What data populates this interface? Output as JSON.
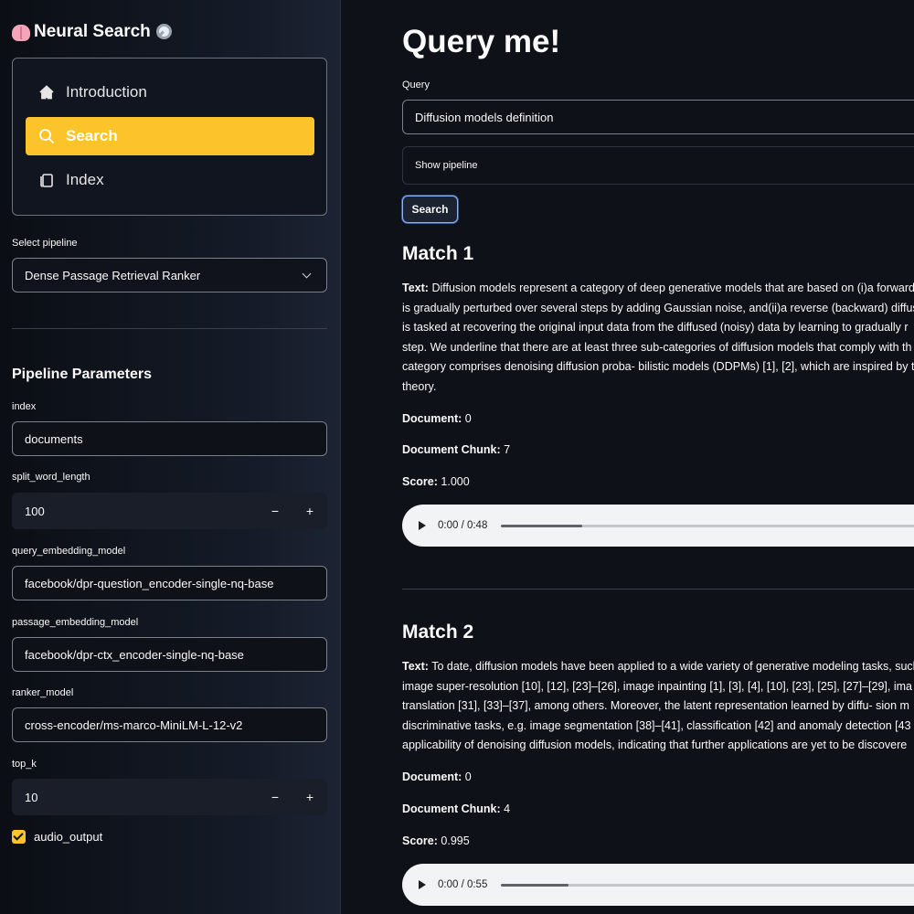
{
  "sidebar": {
    "app_title": "Neural Search",
    "nav": [
      {
        "label": "Introduction",
        "icon": "home-icon",
        "active": false
      },
      {
        "label": "Search",
        "icon": "search-icon",
        "active": true
      },
      {
        "label": "Index",
        "icon": "copy-icon",
        "active": false
      }
    ],
    "pipeline_select": {
      "label": "Select pipeline",
      "value": "Dense Passage Retrieval Ranker"
    },
    "params_heading": "Pipeline Parameters",
    "params": {
      "index": {
        "label": "index",
        "value": "documents"
      },
      "split_word_length": {
        "label": "split_word_length",
        "value": "100"
      },
      "query_embedding_model": {
        "label": "query_embedding_model",
        "value": "facebook/dpr-question_encoder-single-nq-base"
      },
      "passage_embedding_model": {
        "label": "passage_embedding_model",
        "value": "facebook/dpr-ctx_encoder-single-nq-base"
      },
      "ranker_model": {
        "label": "ranker_model",
        "value": "cross-encoder/ms-marco-MiniLM-L-12-v2"
      },
      "top_k": {
        "label": "top_k",
        "value": "10"
      }
    },
    "stepper": {
      "minus": "−",
      "plus": "+"
    },
    "audio_output": {
      "label": "audio_output",
      "checked": true
    }
  },
  "main": {
    "title": "Query me!",
    "query": {
      "label": "Query",
      "value": "Diffusion models definition"
    },
    "expander_label": "Show pipeline",
    "search_button": "Search",
    "labels": {
      "text": "Text",
      "document": "Document",
      "chunk": "Document Chunk",
      "score": "Score"
    },
    "matches": [
      {
        "heading": "Match 1",
        "text_lines": [
          "Diffusion models represent a category of deep generative models that are based on (i)a forward",
          "is gradually perturbed over several steps by adding Gaussian noise, and(ii)a reverse (backward) diffus",
          "is tasked at recovering the original input data from the diffused (noisy) data by learning to gradually r",
          "step. We underline that there are at least three sub-categories of diffusion models that comply with th",
          "category comprises denoising diffusion proba- bilistic models (DDPMs) [1], [2], which are inspired by t",
          "theory."
        ],
        "document": "0",
        "chunk": "7",
        "score": "1.000",
        "audio": {
          "time": "0:00 / 0:48",
          "progress": 0.18
        }
      },
      {
        "heading": "Match 2",
        "text_lines": [
          "To date, diffusion models have been applied to a wide variety of generative modeling tasks, such",
          "image super-resolution [10], [12], [23]–[26], image inpainting [1], [3], [4], [10], [23], [25], [27]–[29], ima",
          "translation [31], [33]–[37], among others. Moreover, the latent representation learned by diffu- sion m",
          "discriminative tasks, e.g. image segmentation [38]–[41], classification [42] and anomaly detection [43",
          "applicability of denoising diffusion models, indicating that further applications are yet to be discovere"
        ],
        "document": "0",
        "chunk": "4",
        "score": "0.995",
        "audio": {
          "time": "0:00 / 0:55",
          "progress": 0.15
        }
      }
    ]
  },
  "colors": {
    "accent": "#fcc32a",
    "background": "#0e1117",
    "focus": "#8ab4f8"
  }
}
